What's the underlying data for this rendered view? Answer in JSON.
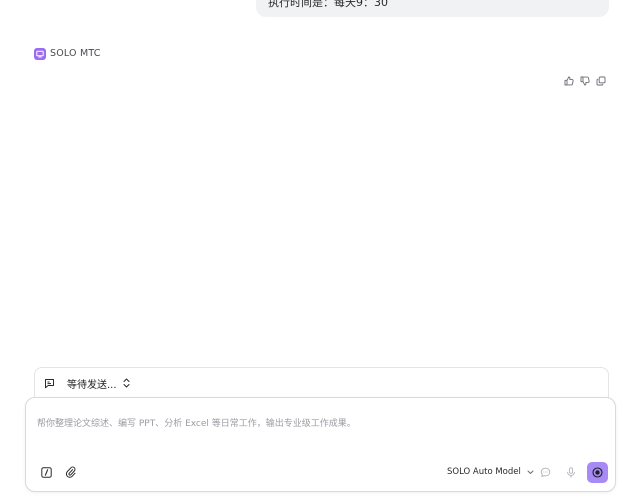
{
  "chat": {
    "user_message": "执行时间是：每天9：30",
    "assistant": {
      "name": "SOLO MTC",
      "avatar_color": "#9b6cf0"
    },
    "feedback": {
      "icons": [
        "thumbs-up-icon",
        "thumbs-down-icon",
        "copy-icon"
      ]
    }
  },
  "queue": {
    "label": "等待发送..."
  },
  "composer": {
    "placeholder": "帮你整理论文综述、编写 PPT、分析 Excel 等日常工作，输出专业级工作成果。",
    "value": "",
    "model_label": "SOLO Auto Model",
    "accent_color": "#a88af5"
  }
}
